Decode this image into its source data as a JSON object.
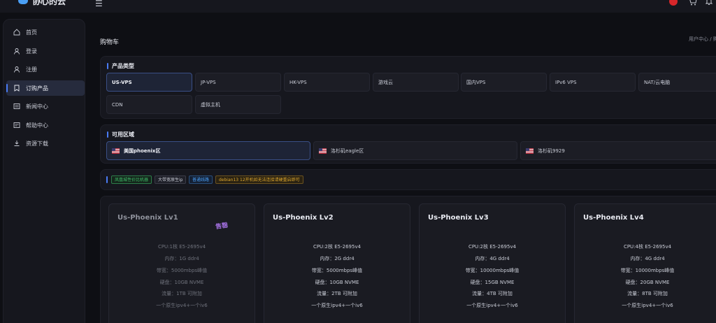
{
  "brand": {
    "name": "协心的云"
  },
  "header": {
    "menu_icon": "☰"
  },
  "sidebar": {
    "items": [
      {
        "label": "首页",
        "icon": "home-icon"
      },
      {
        "label": "登录",
        "icon": "user-icon"
      },
      {
        "label": "注册",
        "icon": "user-plus-icon"
      },
      {
        "label": "订购产品",
        "icon": "bookmark-icon",
        "active": true
      },
      {
        "label": "新闻中心",
        "icon": "news-icon"
      },
      {
        "label": "帮助中心",
        "icon": "help-icon"
      },
      {
        "label": "资源下载",
        "icon": "download-icon"
      }
    ]
  },
  "page": {
    "title": "购物车",
    "breadcrumb": "用户中心 / 购"
  },
  "product_types": {
    "label": "产品类型",
    "items": [
      "US-VPS",
      "JP-VPS",
      "HK-VPS",
      "游戏云",
      "国内VPS",
      "IPv6 VPS",
      "NAT/云电脑",
      "CDN",
      "虚拟主机"
    ],
    "selected": "US-VPS"
  },
  "regions": {
    "label": "可用区域",
    "items": [
      "美国phoenix区",
      "洛杉矶eagle区",
      "洛杉矶9929"
    ],
    "selected": "美国phoenix区"
  },
  "tags": [
    {
      "label": "凤凰城性价比机器",
      "color": "#3fbf6a"
    },
    {
      "label": "大带宽原生ip",
      "color": "#c9ccd6"
    },
    {
      "label": "普通线路",
      "color": "#4a9ff5"
    },
    {
      "label": "debian13 12开机如无法连接请硬重启即可",
      "color": "#e0a82e"
    }
  ],
  "plans": [
    {
      "name": "Us-Phoenix Lv1",
      "muted": true,
      "stamp": "售罄",
      "specs": [
        "CPU:1核 E5-2695v4",
        "内存：1G ddr4",
        "带宽：5000mbps峰值",
        "硬盘：10GB NVME",
        "流量：1TB 可附加",
        "一个原生ipv4+一个iv6"
      ]
    },
    {
      "name": "Us-Phoenix Lv2",
      "muted": false,
      "specs": [
        "CPU:2核 E5-2695v4",
        "内存：2G ddr4",
        "带宽：5000mbps峰值",
        "硬盘：10GB NVME",
        "流量：2TB 可附加",
        "一个原生ipv4+一个iv6"
      ]
    },
    {
      "name": "Us-Phoenix Lv3",
      "muted": false,
      "specs": [
        "CPU:2核 E5-2695v4",
        "内存：4G ddr4",
        "带宽：10000mbps峰值",
        "硬盘：15GB NVME",
        "流量：4TB 可附加",
        "一个原生ipv4+一个iv6"
      ]
    },
    {
      "name": "Us-Phoenix Lv4",
      "muted": false,
      "specs": [
        "CPU:4核 E5-2695v4",
        "内存：4G ddr4",
        "带宽：10000mbps峰值",
        "硬盘：20GB NVME",
        "流量：8TB 可附加",
        "一个原生ipv4+一个iv6"
      ]
    }
  ],
  "colors": {
    "accent": "#4a7cf5",
    "background": "#0e0f14",
    "panel": "#16171e"
  }
}
